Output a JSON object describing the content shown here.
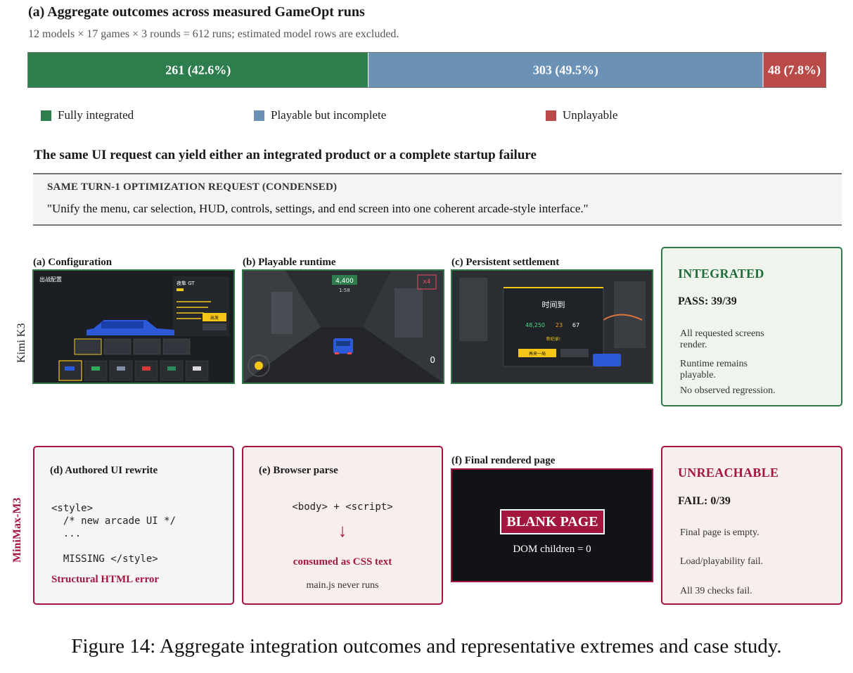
{
  "section_a": {
    "title": "(a) Aggregate outcomes across measured GameOpt runs",
    "subtitle": "12 models × 17 games × 3 rounds = 612 runs; estimated model rows are excluded."
  },
  "chart_data": {
    "type": "bar",
    "orientation": "horizontal-stacked",
    "total": 612,
    "categories": [
      "Fully integrated",
      "Playable but incomplete",
      "Unplayable"
    ],
    "values": [
      261,
      303,
      48
    ],
    "labels": [
      "261 (42.6%)",
      "303 (49.5%)",
      "48 (7.8%)"
    ],
    "colors": [
      "#2e7d4d",
      "#6b91b5",
      "#b94a48"
    ],
    "legend_position": "bottom"
  },
  "case_study": {
    "title": "The same UI request can yield either an integrated product or a complete startup failure",
    "request_label": "SAME TURN-1 OPTIMIZATION REQUEST (CONDENSED)",
    "request_text": "\"Unify the menu, car selection, HUD, controls, settings, and end screen into one coherent arcade-style interface.\""
  },
  "kimi": {
    "row_label": "Kimi K3",
    "panel_a": "(a) Configuration",
    "panel_b": "(b) Playable runtime",
    "panel_c": "(c) Persistent settlement",
    "shot_a": {
      "title": "出战配置",
      "car_name": "夜隼 GT",
      "start_btn": "出发",
      "car_options": [
        "夜隼 GT",
        "",
        "",
        "",
        "",
        ""
      ]
    },
    "shot_b": {
      "score": "4,400",
      "time": "1:58",
      "combo": "x4",
      "speed": "0"
    },
    "shot_c": {
      "title": "时间到",
      "stat1": "48,250",
      "stat2": "23",
      "stat3": "67",
      "record": "新纪录!",
      "again_btn": "再来一局"
    },
    "verdict": {
      "title": "INTEGRATED",
      "score": "PASS: 39/39",
      "lines": [
        "All requested screens render.",
        "Runtime remains playable.",
        "No observed regression."
      ]
    },
    "colors": {
      "accent": "#2f7a48",
      "hud_green": "#2e8b57",
      "hud_yellow": "#f5c518"
    }
  },
  "minimax": {
    "row_label": "MiniMax-M3",
    "card_d": {
      "title": "(d) Authored UI rewrite",
      "code": [
        "<style>",
        "  /* new arcade UI */",
        "  ...",
        "",
        "  MISSING </style>"
      ],
      "error": "Structural HTML error"
    },
    "card_e": {
      "title": "(e) Browser parse",
      "code": "<body> + <script>",
      "arrow": "↓",
      "consumed": "consumed as CSS text",
      "note": "main.js never runs"
    },
    "panel_f": "(f) Final rendered page",
    "blank": {
      "title": "BLANK PAGE",
      "dom": "DOM children = 0"
    },
    "verdict": {
      "title": "UNREACHABLE",
      "score": "FAIL: 0/39",
      "lines": [
        "Final page is empty.",
        "Load/playability fail.",
        "All 39 checks fail."
      ]
    },
    "colors": {
      "accent": "#a3163e"
    }
  },
  "caption": "Figure 14: Aggregate integration outcomes and representative extremes and case study."
}
